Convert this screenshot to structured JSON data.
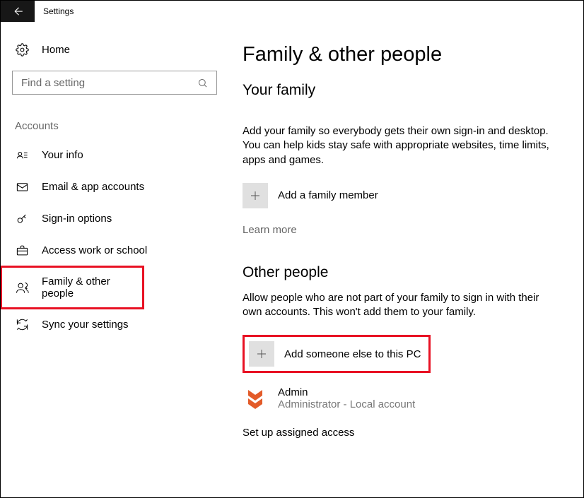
{
  "window": {
    "title": "Settings"
  },
  "sidebar": {
    "home": "Home",
    "search_placeholder": "Find a setting",
    "section": "Accounts",
    "items": [
      {
        "label": "Your info"
      },
      {
        "label": "Email & app accounts"
      },
      {
        "label": "Sign-in options"
      },
      {
        "label": "Access work or school"
      },
      {
        "label": "Family & other people"
      },
      {
        "label": "Sync your settings"
      }
    ]
  },
  "content": {
    "heading": "Family & other people",
    "family": {
      "title": "Your family",
      "desc": "Add your family so everybody gets their own sign-in and desktop. You can help kids stay safe with appropriate websites, time limits, apps and games.",
      "add_label": "Add a family member",
      "learn_more": "Learn more"
    },
    "other": {
      "title": "Other people",
      "desc": "Allow people who are not part of your family to sign in with their own accounts. This won't add them to your family.",
      "add_label": "Add someone else to this PC",
      "user": {
        "name": "Admin",
        "role": "Administrator - Local account"
      },
      "assigned": "Set up assigned access"
    }
  }
}
